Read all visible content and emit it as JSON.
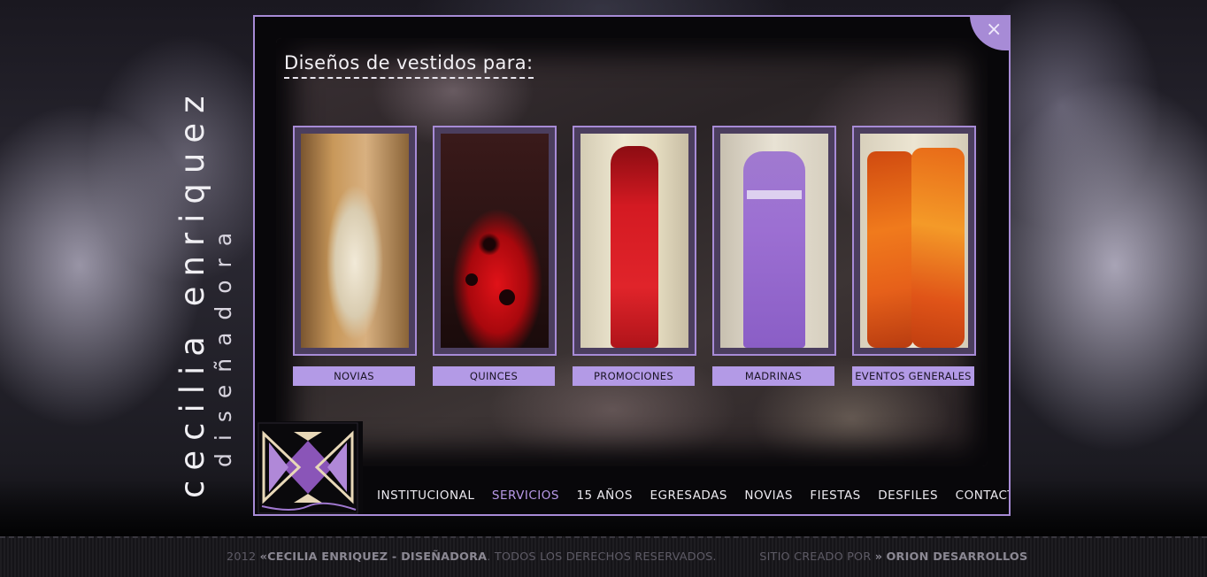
{
  "brand": {
    "name": "cecilia enriquez",
    "subtitle": "diseñadora"
  },
  "panel": {
    "heading": "Diseños de vestidos para:",
    "close_icon": "close-icon",
    "cards": [
      {
        "label": "NOVIAS"
      },
      {
        "label": "QUINCES"
      },
      {
        "label": "PROMOCIONES"
      },
      {
        "label": "MADRINAS"
      },
      {
        "label": "EVENTOS GENERALES"
      }
    ]
  },
  "nav": {
    "items": [
      {
        "label": "INSTITUCIONAL"
      },
      {
        "label": "SERVICIOS",
        "active": true
      },
      {
        "label": "15 AÑOS"
      },
      {
        "label": "EGRESADAS"
      },
      {
        "label": "NOVIAS"
      },
      {
        "label": "FIESTAS"
      },
      {
        "label": "DESFILES"
      },
      {
        "label": "CONTACTO"
      }
    ]
  },
  "footer": {
    "year": "2012",
    "quote": "«",
    "owner": "CECILIA ENRIQUEZ - DISEÑADORA",
    "rights": ". TODOS LOS DERECHOS RESERVADOS.",
    "credit_prefix": "SITIO CREADO POR",
    "credit_arrow": "»",
    "credit_name": "ORION DESARROLLOS"
  },
  "colors": {
    "accent": "#a78bd6",
    "label_bg": "#b39ae6",
    "nav_active": "#b99ae8"
  }
}
